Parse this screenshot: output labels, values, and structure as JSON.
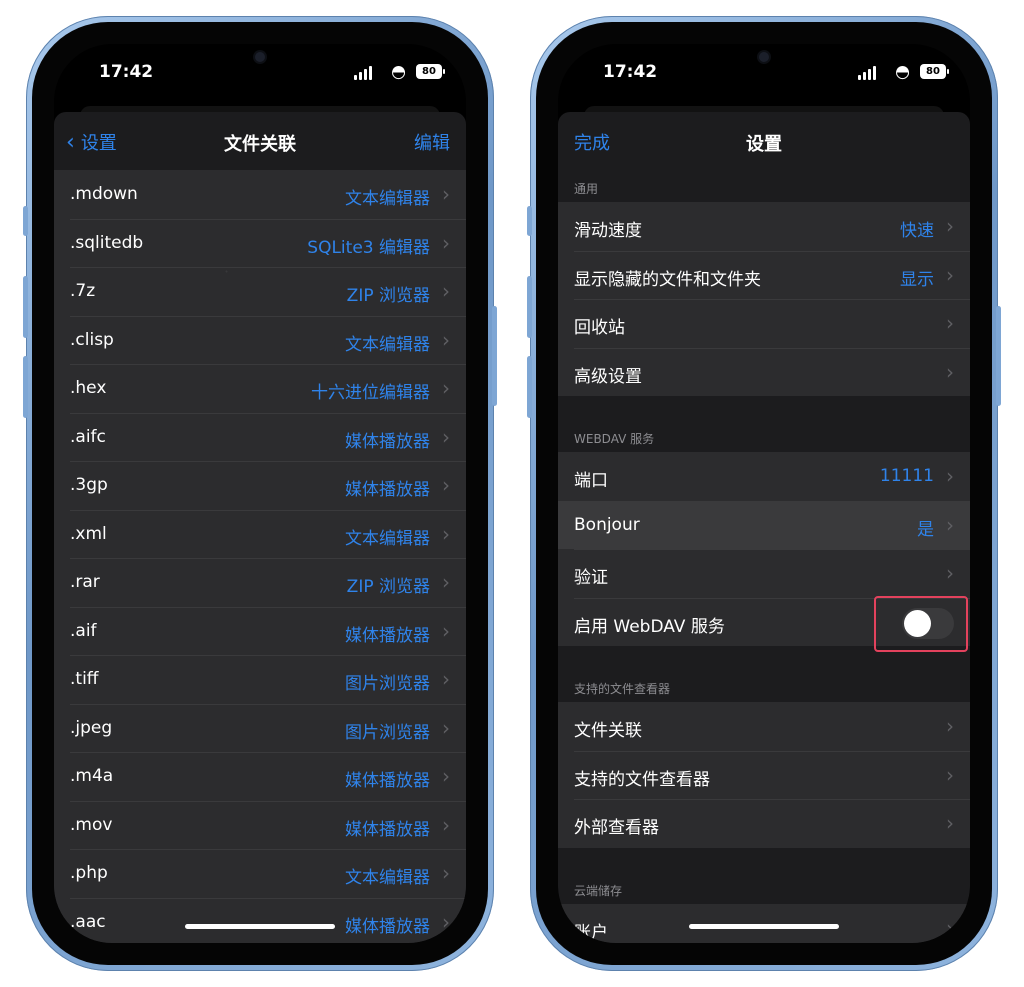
{
  "status_bar": {
    "time": "17:42",
    "battery": "80"
  },
  "left_screen": {
    "nav": {
      "back_label": "设置",
      "title": "文件关联",
      "action_label": "编辑"
    },
    "rows": [
      {
        "ext": ".mdown",
        "app": "文本编辑器"
      },
      {
        "ext": ".sqlitedb",
        "app": "SQLite3 编辑器"
      },
      {
        "ext": ".7z",
        "app": "ZIP 浏览器"
      },
      {
        "ext": ".clisp",
        "app": "文本编辑器"
      },
      {
        "ext": ".hex",
        "app": "十六进位编辑器"
      },
      {
        "ext": ".aifc",
        "app": "媒体播放器"
      },
      {
        "ext": ".3gp",
        "app": "媒体播放器"
      },
      {
        "ext": ".xml",
        "app": "文本编辑器"
      },
      {
        "ext": ".rar",
        "app": "ZIP 浏览器"
      },
      {
        "ext": ".aif",
        "app": "媒体播放器"
      },
      {
        "ext": ".tiff",
        "app": "图片浏览器"
      },
      {
        "ext": ".jpeg",
        "app": "图片浏览器"
      },
      {
        "ext": ".m4a",
        "app": "媒体播放器"
      },
      {
        "ext": ".mov",
        "app": "媒体播放器"
      },
      {
        "ext": ".php",
        "app": "文本编辑器"
      },
      {
        "ext": ".aac",
        "app": "媒体播放器"
      }
    ]
  },
  "right_screen": {
    "nav": {
      "done_label": "完成",
      "title": "设置"
    },
    "general": {
      "header": "通用",
      "items": [
        {
          "label": "滑动速度",
          "value": "快速"
        },
        {
          "label": "显示隐藏的文件和文件夹",
          "value": "显示"
        },
        {
          "label": "回收站",
          "value": ""
        },
        {
          "label": "高级设置",
          "value": ""
        }
      ]
    },
    "webdav": {
      "header": "WEBDAV 服务",
      "items": [
        {
          "label": "端口",
          "value": "11111"
        },
        {
          "label": "Bonjour",
          "value": "是"
        },
        {
          "label": "验证",
          "value": ""
        }
      ],
      "toggle_label": "启用 WebDAV 服务",
      "toggle_on": false
    },
    "viewers": {
      "header": "支持的文件查看器",
      "items": [
        {
          "label": "文件关联"
        },
        {
          "label": "支持的文件查看器"
        },
        {
          "label": "外部查看器"
        }
      ]
    },
    "cloud": {
      "header": "云端储存",
      "items": [
        {
          "label": "账户"
        }
      ]
    }
  },
  "colors": {
    "accent": "#2f83ea",
    "cell": "#2c2c2e",
    "background": "#1c1c1e",
    "highlight_box": "#e3425d",
    "frame": "#8fb4de"
  }
}
